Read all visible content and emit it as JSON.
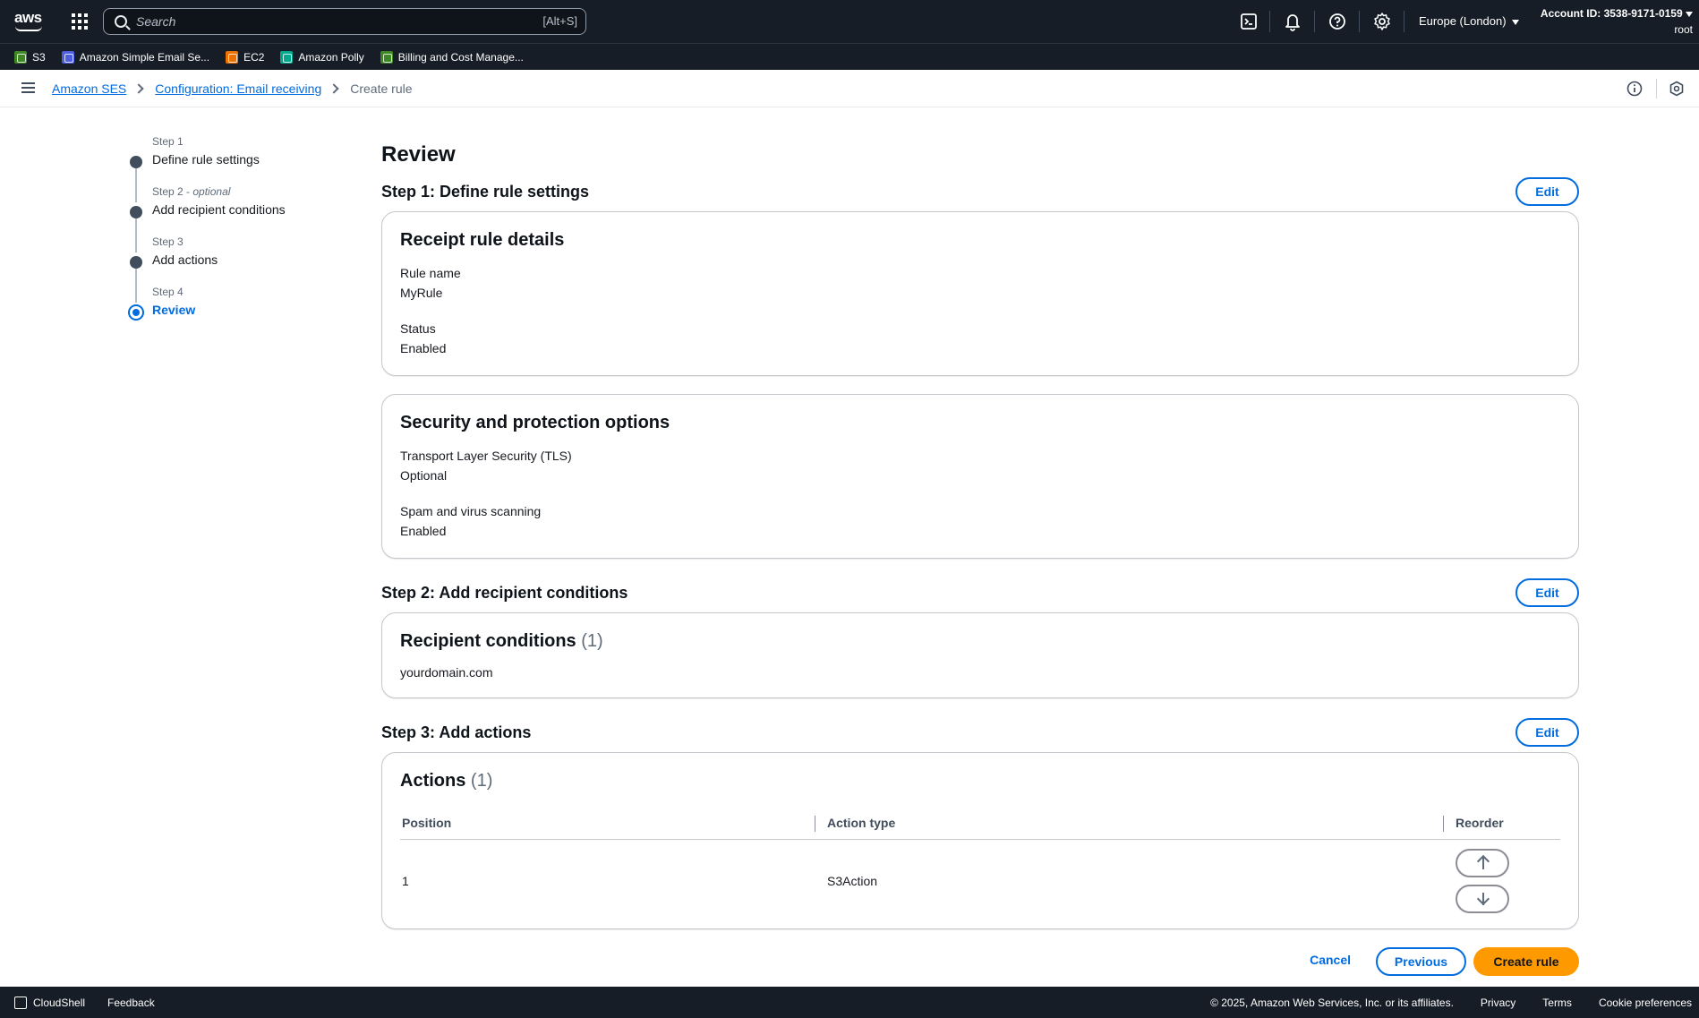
{
  "topnav": {
    "search_placeholder": "Search",
    "search_shortcut": "[Alt+S]",
    "region": "Europe (London)",
    "account_id": "Account ID: 3538-9171-0159",
    "account_user": "root"
  },
  "favorites": [
    {
      "label": "S3",
      "color": "#3f8624"
    },
    {
      "label": "Amazon Simple Email Se...",
      "color": "#4d5fe0"
    },
    {
      "label": "EC2",
      "color": "#ed7100"
    },
    {
      "label": "Amazon Polly",
      "color": "#01a88d"
    },
    {
      "label": "Billing and Cost Manage...",
      "color": "#3f8624"
    }
  ],
  "breadcrumb": {
    "items": [
      "Amazon SES",
      "Configuration: Email receiving"
    ],
    "current": "Create rule"
  },
  "steps": [
    {
      "num": "Step 1",
      "optional": "",
      "title": "Define rule settings"
    },
    {
      "num": "Step 2",
      "optional": "optional",
      "title": "Add recipient conditions"
    },
    {
      "num": "Step 3",
      "optional": "",
      "title": "Add actions"
    },
    {
      "num": "Step 4",
      "optional": "",
      "title": "Review"
    }
  ],
  "main": {
    "title": "Review",
    "edit_label": "Edit",
    "section1": {
      "heading": "Step 1: Define rule settings",
      "card1": {
        "title": "Receipt rule details",
        "rule_name_label": "Rule name",
        "rule_name_value": "MyRule",
        "status_label": "Status",
        "status_value": "Enabled"
      },
      "card2": {
        "title": "Security and protection options",
        "tls_label": "Transport Layer Security (TLS)",
        "tls_value": "Optional",
        "spam_label": "Spam and virus scanning",
        "spam_value": "Enabled"
      }
    },
    "section2": {
      "heading": "Step 2: Add recipient conditions",
      "card_title": "Recipient conditions",
      "count": "(1)",
      "condition": "yourdomain.com"
    },
    "section3": {
      "heading": "Step 3: Add actions",
      "card_title": "Actions",
      "count": "(1)",
      "columns": [
        "Position",
        "Action type",
        "Reorder"
      ],
      "rows": [
        {
          "position": "1",
          "action_type": "S3Action"
        }
      ]
    },
    "buttons": {
      "cancel": "Cancel",
      "previous": "Previous",
      "create": "Create rule"
    }
  },
  "footer": {
    "cloudshell": "CloudShell",
    "feedback": "Feedback",
    "copyright": "© 2025, Amazon Web Services, Inc. or its affiliates.",
    "privacy": "Privacy",
    "terms": "Terms",
    "cookies": "Cookie preferences"
  }
}
